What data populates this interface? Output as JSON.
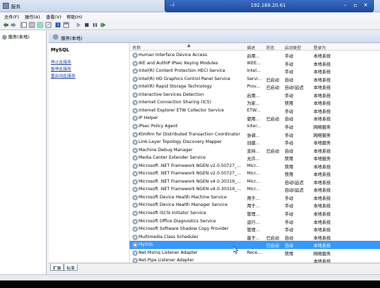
{
  "remote_bar": {
    "ip": "192.168.20.61"
  },
  "window": {
    "title": "服务"
  },
  "menu": [
    "文件(F)",
    "操作(A)",
    "查看(V)",
    "帮助(H)"
  ],
  "tree": {
    "root": "服务(本地)"
  },
  "pane": {
    "header": "服务(本地)",
    "selected_service": "MySQL",
    "links": [
      "停止此服务",
      "暂停此服务",
      "重启动此服务"
    ]
  },
  "columns": [
    "名称",
    "描述",
    "状态",
    "启动类型",
    "登录为"
  ],
  "services": [
    {
      "name": "Human Interface Device Access",
      "desc": "启用...",
      "status": "",
      "start": "手动",
      "logon": "本地系统"
    },
    {
      "name": "IKE and AuthIP IPsec Keying Modules",
      "desc": "IKEE...",
      "status": "",
      "start": "手动",
      "logon": "本地系统"
    },
    {
      "name": "Intel(R) Content Protection HECI Service",
      "desc": "Intel...",
      "status": "",
      "start": "手动",
      "logon": "本地系统"
    },
    {
      "name": "Intel(R) HD Graphics Control Panel Service",
      "desc": "Servi...",
      "status": "已启动",
      "start": "自动",
      "logon": "本地系统"
    },
    {
      "name": "Intel(R) Rapid Storage Technology",
      "desc": "Prov...",
      "status": "已启动",
      "start": "自动(延迟...",
      "logon": "本地系统"
    },
    {
      "name": "Interactive Services Detection",
      "desc": "启用...",
      "status": "",
      "start": "手动",
      "logon": "本地系统"
    },
    {
      "name": "Internet Connection Sharing (ICS)",
      "desc": "为家...",
      "status": "",
      "start": "禁用",
      "logon": "本地系统"
    },
    {
      "name": "Internet Explorer ETW Collector Service",
      "desc": "ETW...",
      "status": "",
      "start": "手动",
      "logon": "本地系统"
    },
    {
      "name": "IP Helper",
      "desc": "使用...",
      "status": "已启动",
      "start": "自动",
      "logon": "本地系统"
    },
    {
      "name": "IPsec Policy Agent",
      "desc": "Inter...",
      "status": "",
      "start": "手动",
      "logon": "网络服务"
    },
    {
      "name": "KtmRm for Distributed Transaction Coordinator",
      "desc": "协调...",
      "status": "",
      "start": "手动",
      "logon": "网络服务"
    },
    {
      "name": "Link-Layer Topology Discovery Mapper",
      "desc": "创建...",
      "status": "",
      "start": "手动",
      "logon": "本地服务"
    },
    {
      "name": "Machine Debug Manager",
      "desc": "支持...",
      "status": "已启动",
      "start": "自动",
      "logon": "本地系统"
    },
    {
      "name": "Media Center Extender Service",
      "desc": "允许...",
      "status": "",
      "start": "禁用",
      "logon": "本地服务"
    },
    {
      "name": "Microsoft .NET Framework NGEN v2.0.50727_...",
      "desc": "Micr...",
      "status": "",
      "start": "禁用",
      "logon": "本地系统"
    },
    {
      "name": "Microsoft .NET Framework NGEN v2.0.50727_...",
      "desc": "Micr...",
      "status": "",
      "start": "禁用",
      "logon": "本地系统"
    },
    {
      "name": "Microsoft .NET Framework NGEN v4.0.30319_...",
      "desc": "Micr...",
      "status": "",
      "start": "自动(延迟...",
      "logon": "本地系统"
    },
    {
      "name": "Microsoft .NET Framework NGEN v4.0.30319_...",
      "desc": "Micr...",
      "status": "",
      "start": "自动(延迟...",
      "logon": "本地系统"
    },
    {
      "name": "Microsoft Device Health Machine Service",
      "desc": "用于...",
      "status": "",
      "start": "手动",
      "logon": "本地系统"
    },
    {
      "name": "Microsoft Device Health Manager Service",
      "desc": "用于...",
      "status": "",
      "start": "手动",
      "logon": "本地系统"
    },
    {
      "name": "Microsoft iSCSI Initiator Service",
      "desc": "管理...",
      "status": "",
      "start": "手动",
      "logon": "本地系统"
    },
    {
      "name": "Microsoft Office Diagnostics Service",
      "desc": "运行...",
      "status": "",
      "start": "手动",
      "logon": "本地系统"
    },
    {
      "name": "Microsoft Software Shadow Copy Provider",
      "desc": "管理...",
      "status": "",
      "start": "手动",
      "logon": "本地系统"
    },
    {
      "name": "Multimedia Class Scheduler",
      "desc": "基于...",
      "status": "已启动",
      "start": "自动",
      "logon": "本地系统"
    },
    {
      "name": "MySQL",
      "desc": "",
      "status": "已启动",
      "start": "自动",
      "logon": "本地系统",
      "selected": true
    },
    {
      "name": "Net.Msmq Listener Adapter",
      "desc": "Rece...",
      "status": "",
      "start": "禁用",
      "logon": "网络服务"
    },
    {
      "name": "Net.Pipe Listener Adapter",
      "desc": "",
      "status": "",
      "start": "",
      "logon": "本地系统"
    }
  ],
  "tabs": [
    "扩展",
    "标准"
  ]
}
